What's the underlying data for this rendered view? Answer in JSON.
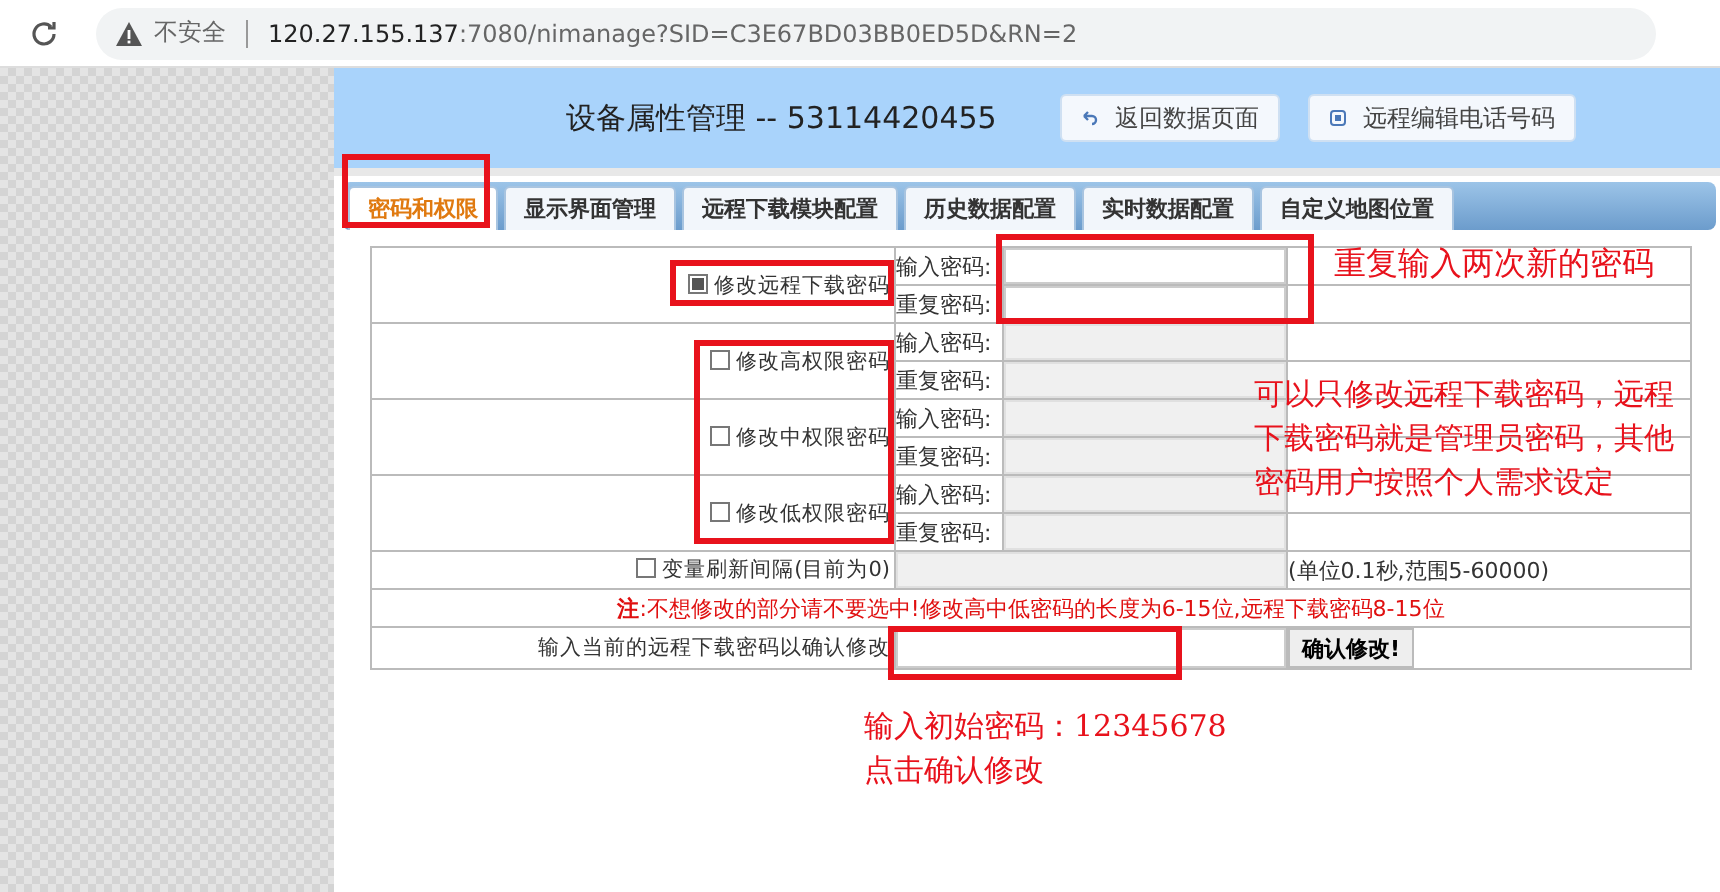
{
  "browser": {
    "security_label": "不安全",
    "url_host": "120.27.155.137",
    "url_rest": ":7080/nimanage?SID=C3E67BD03BB0ED5D&RN=2"
  },
  "header": {
    "title": "设备属性管理 -- 53114420455",
    "buttons": [
      {
        "label": "返回数据页面",
        "kind": "back"
      },
      {
        "label": "远程编辑电话号码",
        "kind": "phone"
      }
    ]
  },
  "tabs": [
    {
      "label": "密码和权限",
      "selected": true
    },
    {
      "label": "显示界面管理",
      "selected": false
    },
    {
      "label": "远程下载模块配置",
      "selected": false
    },
    {
      "label": "历史数据配置",
      "selected": false
    },
    {
      "label": "实时数据配置",
      "selected": false
    },
    {
      "label": "自定义地图位置",
      "selected": false
    }
  ],
  "password_rows": [
    {
      "label": "修改远程下载密码",
      "checked": true,
      "fields": [
        {
          "label": "输入密码:",
          "disabled": false
        },
        {
          "label": "重复密码:",
          "disabled": false
        }
      ]
    },
    {
      "label": "修改高权限密码",
      "checked": false,
      "fields": [
        {
          "label": "输入密码:",
          "disabled": true
        },
        {
          "label": "重复密码:",
          "disabled": true
        }
      ]
    },
    {
      "label": "修改中权限密码",
      "checked": false,
      "fields": [
        {
          "label": "输入密码:",
          "disabled": true
        },
        {
          "label": "重复密码:",
          "disabled": true
        }
      ]
    },
    {
      "label": "修改低权限密码",
      "checked": false,
      "fields": [
        {
          "label": "输入密码:",
          "disabled": true
        },
        {
          "label": "重复密码:",
          "disabled": true
        }
      ]
    }
  ],
  "interval": {
    "label": "变量刷新间隔(目前为0)",
    "checked": false,
    "disabled": true,
    "hint": "(单位0.1秒,范围5-60000)"
  },
  "note": "**注**:不想修改的部分请不要选中!修改高中低密码的长度为6-15位,远程下载密码8-15位",
  "confirm": {
    "label": "输入当前的远程下载密码以确认修改",
    "button": "确认修改!"
  },
  "annotations": [
    {
      "text": "重复输入两次新的密码"
    },
    {
      "text": "可以只修改远程下载密码，远程下载密码就是管理员密码，其他密码用户按照个人需求设定"
    },
    {
      "text": "输入初始密码：12345678"
    },
    {
      "text": "点击确认修改"
    }
  ]
}
